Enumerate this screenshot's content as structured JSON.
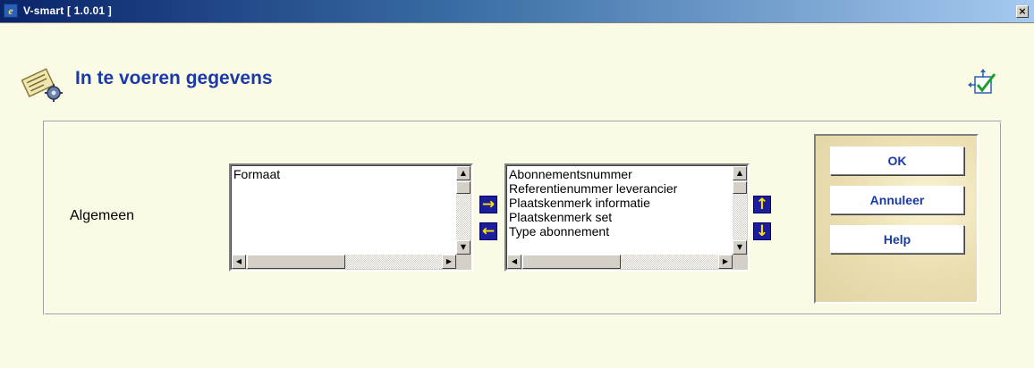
{
  "window": {
    "title": "V-smart [ 1.0.01 ]",
    "close_glyph": "×"
  },
  "header": {
    "title": "In te voeren gegevens",
    "page_icon": "settings-newspaper-icon",
    "help_icon": "help-checkbox-icon"
  },
  "section": {
    "label": "Algemeen"
  },
  "available_list": {
    "items": [
      "Formaat"
    ]
  },
  "selected_list": {
    "items": [
      "Abonnementsnummer",
      "Referentienummer leverancier",
      "Plaatskenmerk informatie",
      "Plaatskenmerk set",
      "Type abonnement"
    ]
  },
  "arrows": {
    "add": "→",
    "remove": "←",
    "up": "↑",
    "down": "↓"
  },
  "scroll_glyphs": {
    "up": "▲",
    "down": "▼",
    "left": "◀",
    "right": "▶"
  },
  "actions": {
    "ok": "OK",
    "cancel": "Annuleer",
    "help": "Help"
  },
  "colors": {
    "title_text": "#1a3aa8",
    "background": "#fbfbe5",
    "arrow_bg": "#1b1d9c",
    "arrow_fg": "#ffe600"
  }
}
